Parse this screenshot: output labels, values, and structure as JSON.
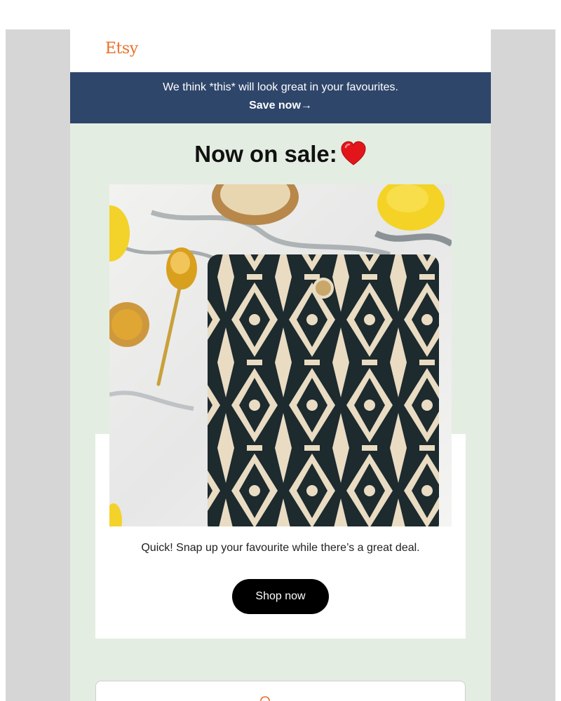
{
  "header": {
    "logo_text": "Etsy"
  },
  "banner": {
    "text": "We think *this* will look great in your favourites.",
    "link_label": "Save now→"
  },
  "main": {
    "headline": "Now on sale:",
    "caption": "Quick! Snap up your favourite while there’s a great deal.",
    "cta_label": "Shop now"
  },
  "colors": {
    "brand": "#e8702a",
    "banner_bg": "#2f466b",
    "email_bg": "#e4ede2",
    "cta_bg": "#000000"
  },
  "icons": [
    "heart-icon",
    "product-image",
    "location-pin-icon"
  ]
}
